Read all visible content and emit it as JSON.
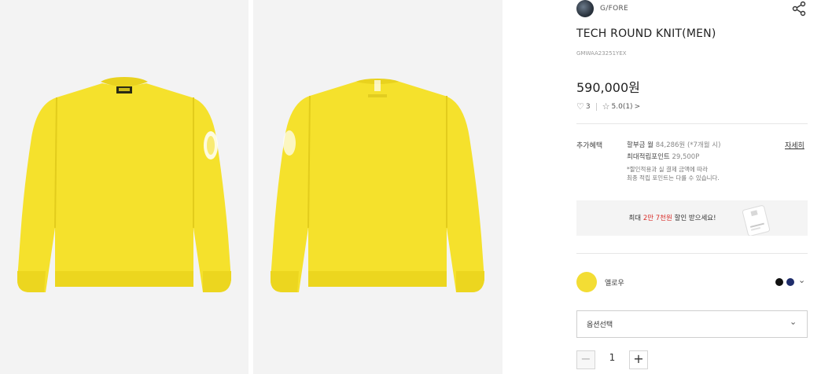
{
  "brand": {
    "name": "G/FORE",
    "logo_icon": "brand-logo-icon"
  },
  "share_icon": "share-icon",
  "product": {
    "title": "TECH ROUND KNIT(MEN)",
    "code": "GMWAA23251YEX",
    "price": "590,000원",
    "wish_count": "3",
    "rating": "5.0",
    "review_count": "(1)",
    "review_arrow": ">"
  },
  "benefit": {
    "label": "추가혜택",
    "installment_label": "할부금 월",
    "installment_value": "84,286원",
    "installment_note": "(*7개월 시)",
    "points_label": "최대적립포인트",
    "points_value": "29,500P",
    "note_line1": "*할인적용과 실 결제 금액에 따라",
    "note_line2": "최종 적립 포인트는 다를 수 있습니다.",
    "detail_link": "자세히"
  },
  "promo": {
    "prefix": "최대 ",
    "highlight": "2만 7천원",
    "suffix": " 할인 받으세요!"
  },
  "color": {
    "selected": "옐로우",
    "selected_hex": "#f3dd34",
    "options": [
      "#111111",
      "#1f2d6b"
    ]
  },
  "option_select": {
    "label": "옵션선택"
  },
  "quantity": {
    "value": "1",
    "minus": "−",
    "plus": "+"
  },
  "images": {
    "main_color": "#f5e12c",
    "panel_bg": "#f3f3f3"
  }
}
